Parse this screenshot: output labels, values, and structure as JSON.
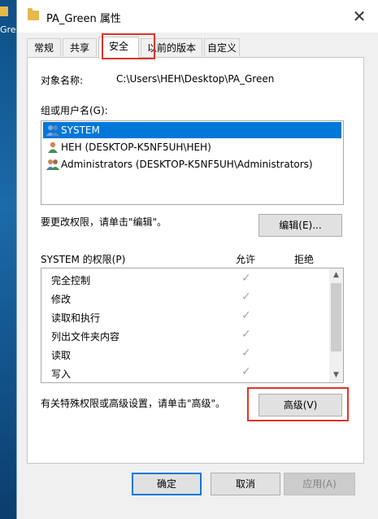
{
  "desktop": {
    "label": "Gree"
  },
  "window": {
    "title": "PA_Green 属性"
  },
  "tabs": [
    {
      "label": "常规"
    },
    {
      "label": "共享"
    },
    {
      "label": "安全"
    },
    {
      "label": "以前的版本"
    },
    {
      "label": "自定义"
    }
  ],
  "security": {
    "object_label": "对象名称:",
    "object_value": "C:\\Users\\HEH\\Desktop\\PA_Green",
    "groups_label": "组或用户名(G):",
    "groups": [
      {
        "name": "SYSTEM",
        "selected": true
      },
      {
        "name": "HEH (DESKTOP-K5NF5UH\\HEH)",
        "selected": false
      },
      {
        "name": "Administrators (DESKTOP-K5NF5UH\\Administrators)",
        "selected": false
      }
    ],
    "edit_hint": "要更改权限，请单击\"编辑\"。",
    "edit_button": "编辑(E)...",
    "perm_title": "SYSTEM 的权限(P)",
    "allow_header": "允许",
    "deny_header": "拒绝",
    "permissions": [
      {
        "name": "完全控制",
        "allow": "✓"
      },
      {
        "name": "修改",
        "allow": "✓"
      },
      {
        "name": "读取和执行",
        "allow": "✓"
      },
      {
        "name": "列出文件夹内容",
        "allow": "✓"
      },
      {
        "name": "读取",
        "allow": "✓"
      },
      {
        "name": "写入",
        "allow": "✓"
      }
    ],
    "advanced_hint": "有关特殊权限或高级设置，请单击\"高级\"。",
    "advanced_button": "高级(V)"
  },
  "footer": {
    "ok": "确定",
    "cancel": "取消",
    "apply": "应用(A)"
  },
  "colors": {
    "selection": "#0078d7",
    "highlight_box": "#e0332b"
  }
}
